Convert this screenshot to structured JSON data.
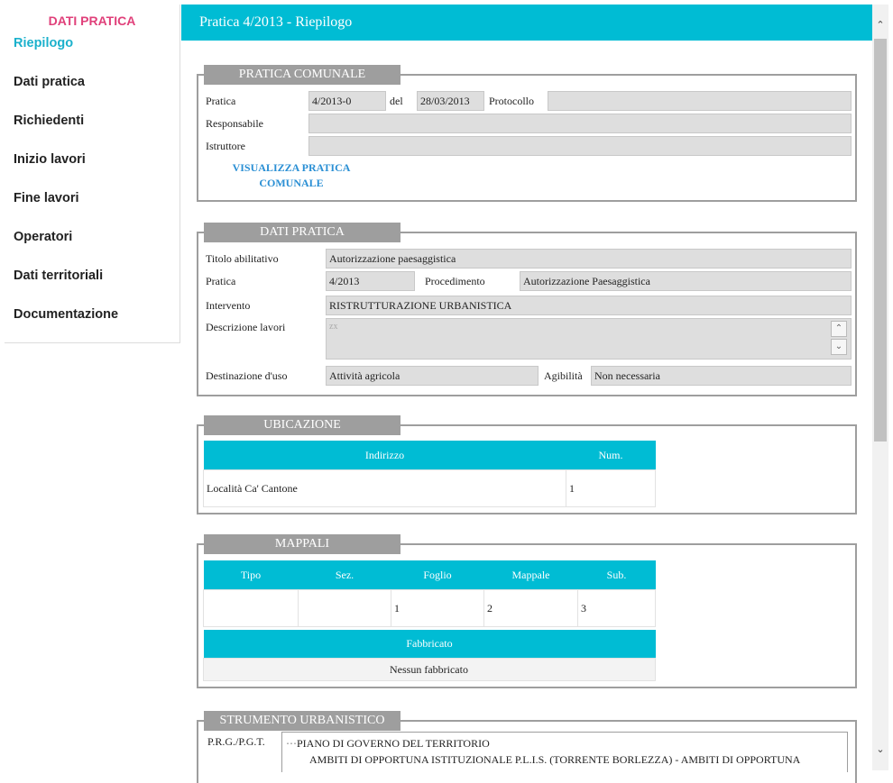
{
  "sidebar": {
    "title": "DATI PRATICA",
    "items": [
      {
        "label": "Riepilogo"
      },
      {
        "label": "Dati pratica"
      },
      {
        "label": "Richiedenti"
      },
      {
        "label": "Inizio lavori"
      },
      {
        "label": "Fine lavori"
      },
      {
        "label": "Operatori"
      },
      {
        "label": "Dati territoriali"
      },
      {
        "label": "Documentazione"
      }
    ]
  },
  "header": {
    "title": "Pratica 4/2013 - Riepilogo"
  },
  "pratica_comunale": {
    "title": "PRATICA COMUNALE",
    "pratica_label": "Pratica",
    "pratica_value": "4/2013-0",
    "del_label": "del",
    "del_value": "28/03/2013",
    "protocollo_label": "Protocollo",
    "protocollo_value": "",
    "responsabile_label": "Responsabile",
    "responsabile_value": "",
    "istruttore_label": "Istruttore",
    "istruttore_value": "",
    "link_line1": "VISUALIZZA PRATICA",
    "link_line2": "COMUNALE"
  },
  "dati_pratica": {
    "title": "DATI PRATICA",
    "titolo_label": "Titolo abilitativo",
    "titolo_value": "Autorizzazione paesaggistica",
    "pratica_label": "Pratica",
    "pratica_value": "4/2013",
    "procedimento_label": "Procedimento",
    "procedimento_value": "Autorizzazione Paesaggistica",
    "intervento_label": "Intervento",
    "intervento_value": "RISTRUTTURAZIONE URBANISTICA",
    "descrizione_label": "Descrizione lavori",
    "descrizione_value": "zx",
    "destinazione_label": "Destinazione d'uso",
    "destinazione_value": "Attività agricola",
    "agibilita_label": "Agibilità",
    "agibilita_value": "Non necessaria"
  },
  "ubicazione": {
    "title": "UBICAZIONE",
    "columns": [
      "Indirizzo",
      "Num."
    ],
    "rows": [
      [
        "Località Ca' Cantone",
        "1"
      ]
    ]
  },
  "mappali": {
    "title": "MAPPALI",
    "columns": [
      "Tipo",
      "Sez.",
      "Foglio",
      "Mappale",
      "Sub."
    ],
    "rows": [
      [
        "",
        "",
        "1",
        "2",
        "3"
      ]
    ],
    "fabbricato_header": "Fabbricato",
    "fabbricato_value": "Nessun fabbricato"
  },
  "strumento": {
    "title": "STRUMENTO URBANISTICO",
    "label": "P.R.G./P.G.T.",
    "tree_line1": "PIANO DI GOVERNO DEL TERRITORIO",
    "tree_line2": "AMBITI DI OPPORTUNA ISTITUZIONALE P.L.I.S. (TORRENTE BORLEZZA) - AMBITI DI OPPORTUNA"
  },
  "colors": {
    "accent": "#00bcd4",
    "sidebar_title": "#e0407a",
    "section_tab": "#9e9e9e",
    "link": "#2a8fd4"
  }
}
